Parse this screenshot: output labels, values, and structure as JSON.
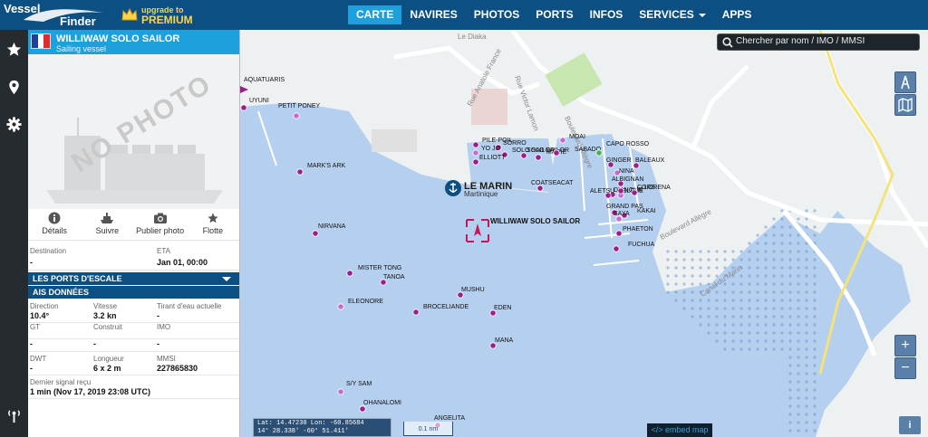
{
  "header": {
    "logo_line1": "Vessel",
    "logo_line2": "Finder",
    "upgrade_small": "upgrade to",
    "upgrade_big": "PREMIUM",
    "nav": [
      {
        "label": "CARTE",
        "active": true
      },
      {
        "label": "NAVIRES"
      },
      {
        "label": "PHOTOS"
      },
      {
        "label": "PORTS"
      },
      {
        "label": "INFOS"
      },
      {
        "label": "SERVICES"
      },
      {
        "label": "APPS"
      }
    ]
  },
  "left_rail": {
    "icons": [
      "star-icon",
      "location-pin-icon",
      "gear-icon",
      "antenna-icon"
    ]
  },
  "vessel": {
    "name": "WILLIWAW SOLO SAILOR",
    "type": "Sailing vessel",
    "photo_placeholder": "NO PHOTO",
    "actions": [
      {
        "label": "Détails",
        "icon": "info-icon"
      },
      {
        "label": "Suivre",
        "icon": "ship-icon"
      },
      {
        "label": "Publier photo",
        "icon": "camera-icon"
      },
      {
        "label": "Flotte",
        "icon": "star-icon"
      }
    ],
    "destination_label": "Destination",
    "destination_value": "-",
    "eta_label": "ETA",
    "eta_value": "Jan 01, 00:00",
    "ports_section": "LES PORTS D'ESCALE",
    "ais_section": "AIS DONNÉES",
    "direction_label": "Direction",
    "direction_value": "10.4°",
    "speed_label": "Vitesse",
    "speed_value": "3.2 kn",
    "draft_label": "Tirant d'eau actuelle",
    "draft_value": "-",
    "gt_label": "GT",
    "gt_value": "-",
    "built_label": "Construit",
    "built_value": "-",
    "imo_label": "IMO",
    "imo_value": "-",
    "dwt_label": "DWT",
    "dwt_value": "-",
    "length_label": "Longueur",
    "length_value": "6 x 2 m",
    "mmsi_label": "MMSI",
    "mmsi_value": "227865830",
    "last_signal_label": "Dernier signal reçu",
    "last_signal_value": "1 min (Nov 17, 2019 23:08 UTC)"
  },
  "map": {
    "search_placeholder": "Chercher par nom / IMO / MMSI",
    "port_name": "LE MARIN",
    "port_region": "Martinique",
    "selected_vessel": "WILLIWAW SOLO SAILOR",
    "streets": [
      "Rue Victor Lamon",
      "Rue Anatole France",
      "Boulevard Allègre",
      "Boulevard Allègre",
      "Canal du Marin",
      "Le Diaka"
    ],
    "vessels": [
      {
        "name": "AQUATUARIS"
      },
      {
        "name": "UYUNI"
      },
      {
        "name": "PETIT PONEY"
      },
      {
        "name": "MARK'S ARK"
      },
      {
        "name": "NIRVANA"
      },
      {
        "name": "MISTER TONG"
      },
      {
        "name": "TANOA"
      },
      {
        "name": "ELEONORE"
      },
      {
        "name": "MUSHU"
      },
      {
        "name": "BROCELIANDE"
      },
      {
        "name": "EDEN"
      },
      {
        "name": "MANA"
      },
      {
        "name": "S/Y SAM"
      },
      {
        "name": "OHANALOMI"
      },
      {
        "name": "ANGELITA"
      },
      {
        "name": "PILE-POIL"
      },
      {
        "name": "SORRO"
      },
      {
        "name": "YO JO"
      },
      {
        "name": "SOLO SAILOR"
      },
      {
        "name": "ELLIOTT"
      },
      {
        "name": "SOLO SAILOR"
      },
      {
        "name": "MARIE"
      },
      {
        "name": "MOAI"
      },
      {
        "name": "SABADO"
      },
      {
        "name": "CAPO ROSSO"
      },
      {
        "name": "GINGER"
      },
      {
        "name": "BALEAUX"
      },
      {
        "name": "NINA"
      },
      {
        "name": "ALBIGNAN"
      },
      {
        "name": "COATSEACAT"
      },
      {
        "name": "DIANOUR"
      },
      {
        "name": "ALETSU"
      },
      {
        "name": "BLEUE"
      },
      {
        "name": "LORENA"
      },
      {
        "name": "CORE"
      },
      {
        "name": "GRAND PAS"
      },
      {
        "name": "KAKAI"
      },
      {
        "name": "SAYA"
      },
      {
        "name": "PHAETON"
      },
      {
        "name": "FUCHUA"
      }
    ],
    "coords_line1": "Lat: 14.47230    Lon: -60.85684",
    "coords_line2": "14° 28.338'    -60° 51.411'",
    "scale_label": "0.1 nm",
    "embed_label": "</> embed map",
    "zoom_in": "+",
    "zoom_out": "−",
    "info_label": "i",
    "colors": {
      "water": "#b5cfee",
      "land": "#eef1f2",
      "vessel": "#9b1e8c",
      "accent": "#1ea0dc",
      "header": "#0c4f82"
    }
  }
}
